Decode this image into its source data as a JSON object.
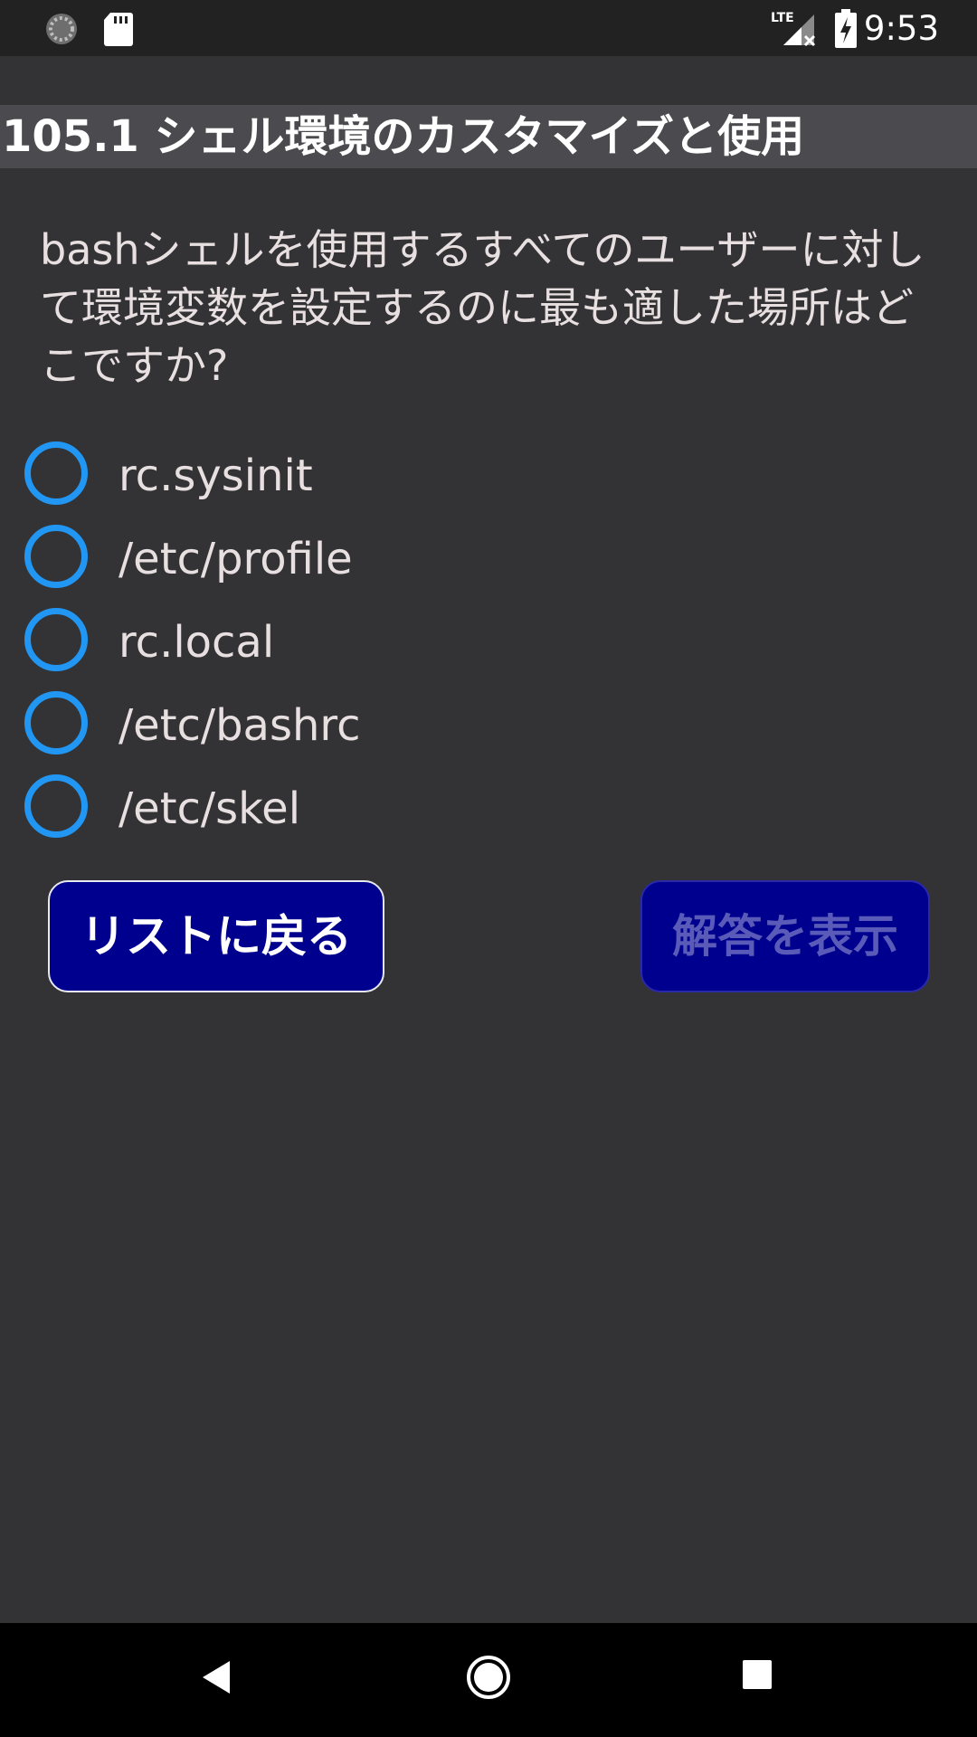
{
  "status_bar": {
    "time": "9:53",
    "network": "LTE",
    "icons": [
      "loading-icon",
      "sd-card-icon",
      "signal-icon",
      "battery-charging-icon"
    ]
  },
  "title": "105.1 シェル環境のカスタマイズと使用",
  "question": "bashシェルを使用するすべてのユーザーに対して環境変数を設定するのに最も適した場所はどこですか?",
  "options": [
    {
      "label": "rc.sysinit",
      "selected": false
    },
    {
      "label": "/etc/profile",
      "selected": false
    },
    {
      "label": "rc.local",
      "selected": false
    },
    {
      "label": "/etc/bashrc",
      "selected": false
    },
    {
      "label": "/etc/skel",
      "selected": false
    }
  ],
  "buttons": {
    "back_label": "リストに戻る",
    "show_answer_label": "解答を表示"
  },
  "nav_bar": {
    "icons": [
      "back-icon",
      "home-icon",
      "recents-icon"
    ]
  },
  "colors": {
    "accent": "#2196f3",
    "button_bg": "#00008f",
    "app_bg": "#333335",
    "title_bg": "#4b4b4f"
  }
}
